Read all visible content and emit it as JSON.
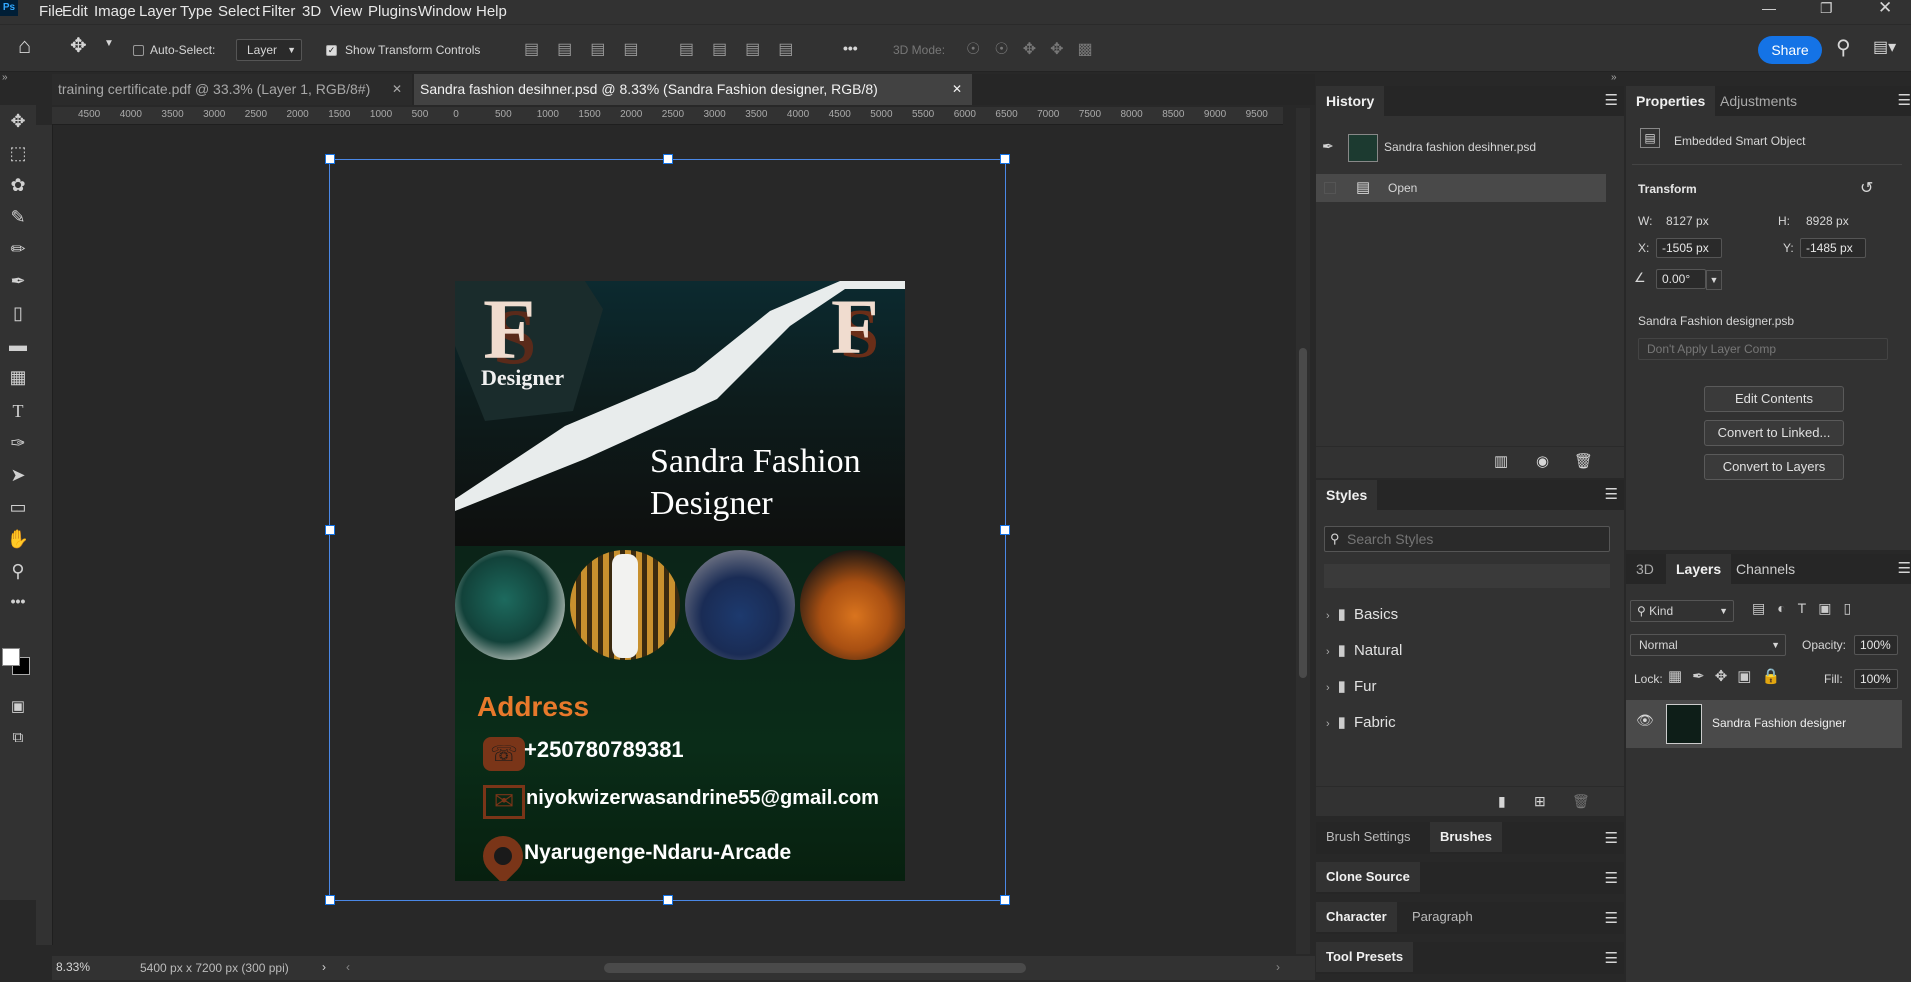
{
  "app": {
    "logo": "Ps"
  },
  "menu": [
    "File",
    "Edit",
    "Image",
    "Layer",
    "Type",
    "Select",
    "Filter",
    "3D",
    "View",
    "Plugins",
    "Window",
    "Help"
  ],
  "options": {
    "auto_select_label": "Auto-Select:",
    "auto_select_target": "Layer",
    "show_transform_label": "Show Transform Controls",
    "mode_3d": "3D Mode:",
    "share": "Share",
    "more": "•••"
  },
  "tabs": [
    {
      "label": "training certificate.pdf @ 33.3% (Layer 1, RGB/8#)"
    },
    {
      "label": "Sandra fashion desihner.psd @ 8.33% (Sandra Fashion designer, RGB/8)"
    }
  ],
  "ruler": {
    "ticks": [
      "4500",
      "4000",
      "3500",
      "3000",
      "2500",
      "2000",
      "1500",
      "1000",
      "500",
      "0",
      "500",
      "1000",
      "1500",
      "2000",
      "2500",
      "3000",
      "3500",
      "4000",
      "4500",
      "5000",
      "5500",
      "6000",
      "6500",
      "7000",
      "7500",
      "8000",
      "8500",
      "9000",
      "9500"
    ]
  },
  "flyer": {
    "logo_letter": "F",
    "logo_shadow": "S",
    "logo_caption": "Designer",
    "title_line1": "Sandra Fashion",
    "title_line2": "Designer",
    "address_heading": "Address",
    "phone": "+250780789381",
    "email": "niyokwizerwasandrine55@gmail.com",
    "location": "Nyarugenge-Ndaru-Arcade"
  },
  "status": {
    "zoom": "8.33%",
    "doc_size": "5400 px x 7200 px (300 ppi)"
  },
  "history": {
    "tab": "History",
    "file": "Sandra fashion desihner.psd",
    "step": "Open"
  },
  "styles": {
    "tab": "Styles",
    "search_placeholder": "Search Styles",
    "folders": [
      "Basics",
      "Natural",
      "Fur",
      "Fabric"
    ]
  },
  "bottom_panels": {
    "brush_settings": "Brush Settings",
    "brushes": "Brushes",
    "clone_source": "Clone Source",
    "character": "Character",
    "paragraph": "Paragraph",
    "tool_presets": "Tool Presets"
  },
  "properties": {
    "tab": "Properties",
    "adjustments_tab": "Adjustments",
    "object_type": "Embedded Smart Object",
    "transform": "Transform",
    "w_label": "W:",
    "w_value": "8127 px",
    "h_label": "H:",
    "h_value": "8928 px",
    "x_label": "X:",
    "x_value": "-1505 px",
    "y_label": "Y:",
    "y_value": "-1485 px",
    "angle": "0.00°",
    "linked_file": "Sandra Fashion designer.psb",
    "layer_comp": "Don't Apply Layer Comp",
    "edit_contents": "Edit Contents",
    "convert_linked": "Convert to Linked...",
    "convert_layers": "Convert to Layers"
  },
  "layers": {
    "tab_3d": "3D",
    "tab_layers": "Layers",
    "tab_channels": "Channels",
    "kind": "Kind",
    "blend": "Normal",
    "opacity_label": "Opacity:",
    "opacity": "100%",
    "lock_label": "Lock:",
    "fill_label": "Fill:",
    "fill": "100%",
    "layer_name": "Sandra Fashion designer"
  },
  "colors": {
    "accent": "#1473e6",
    "orange": "#e8792b",
    "flyer_dark": "#0d1410",
    "flyer_green": "#0c2a18"
  }
}
